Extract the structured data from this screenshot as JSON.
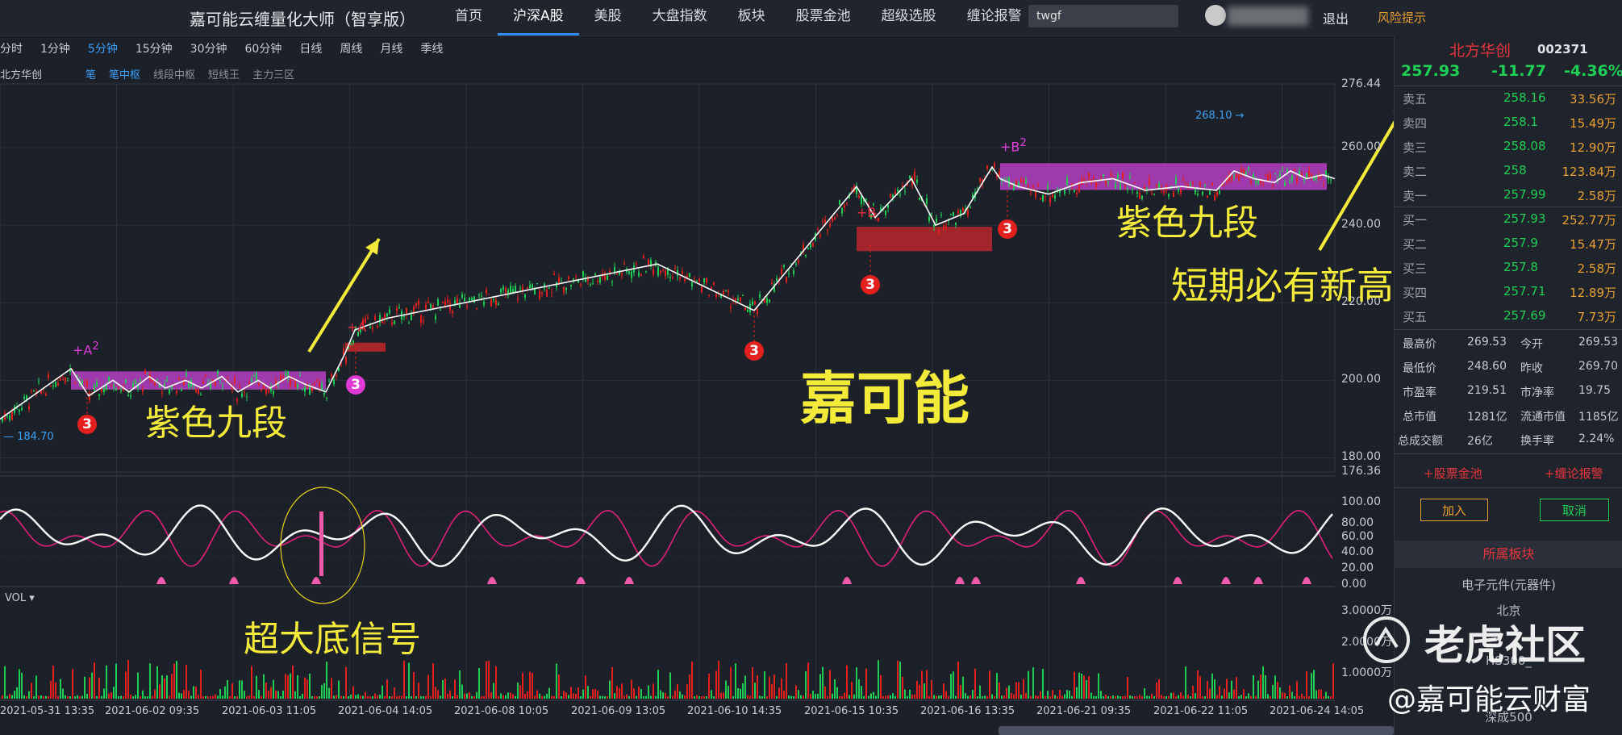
{
  "app": {
    "title": "嘉可能云缠量化大师（智享版）"
  },
  "nav": {
    "items": [
      "首页",
      "沪深A股",
      "美股",
      "大盘指数",
      "板块",
      "股票金池",
      "超级选股",
      "缠论报警"
    ],
    "active_index": 1
  },
  "search": {
    "value": "twgf"
  },
  "user": {
    "logout": "退出",
    "risk": "风险提示"
  },
  "periods": {
    "items": [
      "分时",
      "1分钟",
      "5分钟",
      "15分钟",
      "30分钟",
      "60分钟",
      "日线",
      "周线",
      "月线",
      "季线"
    ],
    "active_index": 2
  },
  "indicators": {
    "stock_tag": "北方华创",
    "items": [
      {
        "label": "笔",
        "on": true
      },
      {
        "label": "笔中枢",
        "on": true
      },
      {
        "label": "线段中枢",
        "on": false
      },
      {
        "label": "短线王",
        "on": false
      },
      {
        "label": "主力三区",
        "on": false
      }
    ]
  },
  "price_axis": [
    "276.44",
    "260.00",
    "240.00",
    "220.00",
    "200.00",
    "180.00"
  ],
  "osc_axis": [
    "176.36",
    "100.00",
    "80.00",
    "60.00",
    "40.00",
    "20.00",
    "0.00"
  ],
  "vol_axis": [
    "3.0000万",
    "2.0000万",
    "1.0000万"
  ],
  "vol_label": "VOL",
  "x_axis": [
    "2021-05-31 13:35",
    "2021-06-02 09:35",
    "2021-06-03 11:05",
    "2021-06-04 14:05",
    "2021-06-08 10:05",
    "2021-06-09 13:05",
    "2021-06-10 14:35",
    "2021-06-15 10:35",
    "2021-06-16 13:35",
    "2021-06-21 09:35",
    "2021-06-22 11:05",
    "2021-06-24 14:05"
  ],
  "annotations": {
    "purple_nine_left": "紫色九段",
    "purple_nine_right": "紫色九段",
    "brand_center": "嘉可能",
    "new_high": "短期必有新高",
    "super_bottom": "超大底信号",
    "low_price": "184.70",
    "high_price": "268.10",
    "mark_a2": "+A",
    "mark_a": "+A",
    "mark_b": "+B",
    "mark_b2": "+B",
    "sig": "3",
    "sup2": "2"
  },
  "panel": {
    "name": "北方华创",
    "code": "002371",
    "price": "257.93",
    "change": "-11.77",
    "change_pct": "-4.36%",
    "sells": [
      {
        "label": "卖五",
        "price": "258.16",
        "vol": "33.56万"
      },
      {
        "label": "卖四",
        "price": "258.1",
        "vol": "15.49万"
      },
      {
        "label": "卖三",
        "price": "258.08",
        "vol": "12.90万"
      },
      {
        "label": "卖二",
        "price": "258",
        "vol": "123.84万"
      },
      {
        "label": "卖一",
        "price": "257.99",
        "vol": "2.58万"
      }
    ],
    "buys": [
      {
        "label": "买一",
        "price": "257.93",
        "vol": "252.77万"
      },
      {
        "label": "买二",
        "price": "257.9",
        "vol": "15.47万"
      },
      {
        "label": "买三",
        "price": "257.8",
        "vol": "2.58万"
      },
      {
        "label": "买四",
        "price": "257.71",
        "vol": "12.89万"
      },
      {
        "label": "买五",
        "price": "257.69",
        "vol": "7.73万"
      }
    ],
    "stats": [
      {
        "k1": "最高价",
        "v1": "269.53",
        "k2": "今开",
        "v2": "269.53"
      },
      {
        "k1": "最低价",
        "v1": "248.60",
        "k2": "昨收",
        "v2": "269.70"
      },
      {
        "k1": "市盈率",
        "v1": "219.51",
        "k2": "市净率",
        "v2": "19.75"
      },
      {
        "k1": "总市值",
        "v1": "1281亿",
        "k2": "流通市值",
        "v2": "1185亿"
      },
      {
        "k1": "总成交额",
        "v1": "26亿",
        "k2": "换手率",
        "v2": "2.24%"
      }
    ],
    "link_pool": "+股票金池",
    "link_alarm": "+缠论报警",
    "add": "加入",
    "cancel": "取消",
    "section": "所属板块",
    "blocks": [
      "电子元件(元器件)",
      "北京",
      "HS300_",
      "深成500"
    ]
  },
  "watermark": {
    "tiger": "老虎社区",
    "handle": "@嘉可能云财富"
  },
  "colors": {
    "up": "#e3201d",
    "down": "#1fcf55",
    "accent": "#2f8ff0",
    "zone_purple": "#b63fc4",
    "zone_red": "#b8272a",
    "annotation": "#f4ea3a"
  }
}
